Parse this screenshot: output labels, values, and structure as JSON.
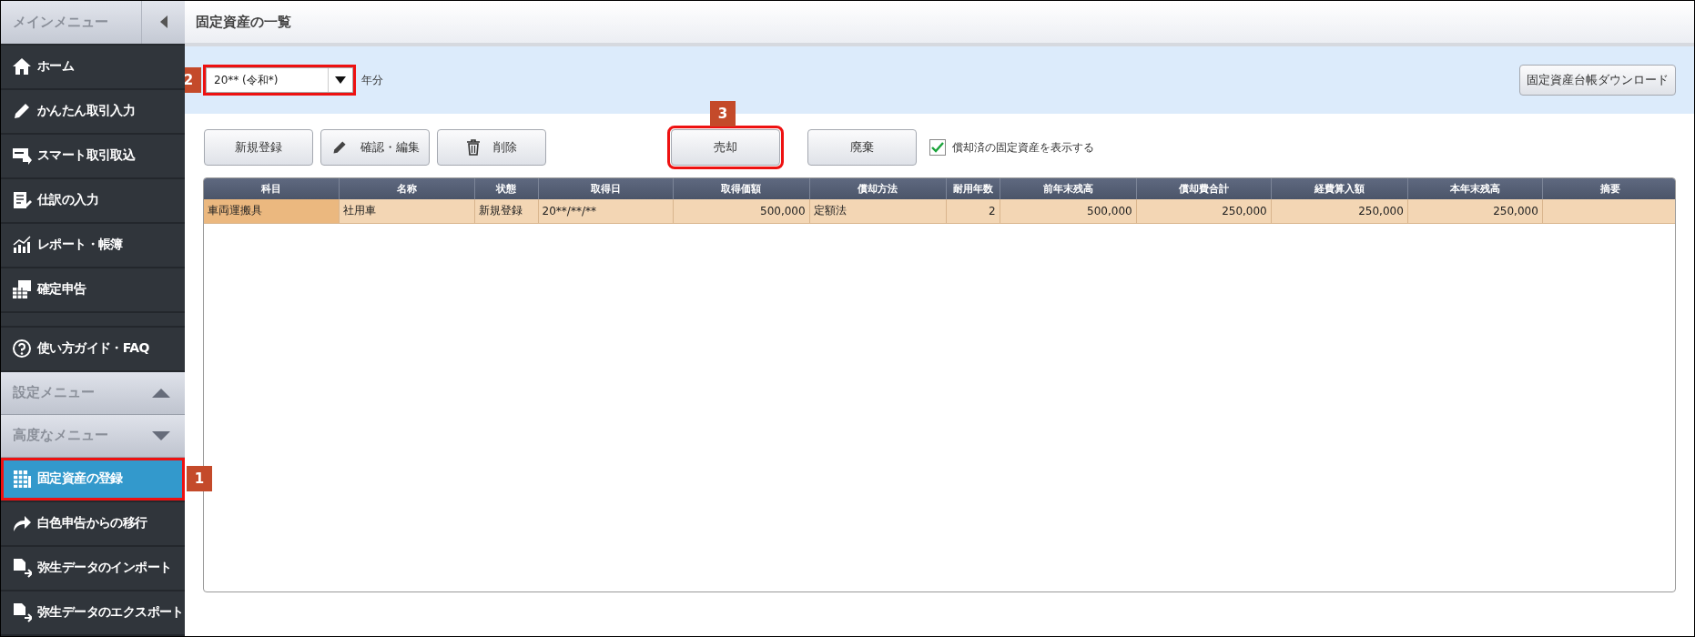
{
  "sidebar": {
    "title": "メインメニュー",
    "entries": [
      {
        "kind": "item",
        "label": "ホーム",
        "selected": false
      },
      {
        "kind": "item",
        "label": "かんたん取引入力",
        "selected": false
      },
      {
        "kind": "item",
        "label": "スマート取引取込",
        "selected": false
      },
      {
        "kind": "item",
        "label": "仕訳の入力",
        "selected": false
      },
      {
        "kind": "item",
        "label": "レポート・帳簿",
        "selected": false
      },
      {
        "kind": "item",
        "label": "確定申告",
        "selected": false
      },
      {
        "kind": "help",
        "label": "使い方ガイド・FAQ",
        "selected": false
      },
      {
        "kind": "section",
        "label": "設定メニュー",
        "expanded": true
      },
      {
        "kind": "section",
        "label": "高度なメニュー",
        "expanded": false
      },
      {
        "kind": "item",
        "label": "固定資産の登録",
        "selected": true,
        "callout": "1"
      },
      {
        "kind": "item",
        "label": "白色申告からの移行",
        "selected": false
      },
      {
        "kind": "item",
        "label": "弥生データのインポート",
        "selected": false
      },
      {
        "kind": "item",
        "label": "弥生データのエクスポート",
        "selected": false
      }
    ]
  },
  "page": {
    "title": "固定資産の一覧"
  },
  "filter": {
    "year": "20** (令和*)",
    "suffix": "年分",
    "callout": "2",
    "download": "固定資産台帳ダウンロード"
  },
  "toolbar": {
    "left_buttons": [
      {
        "label": "新規登録"
      },
      {
        "label": "確認・編集"
      },
      {
        "label": "削除"
      }
    ],
    "right_buttons": [
      {
        "label": "売却",
        "callout": "3"
      },
      {
        "label": "廃棄"
      }
    ],
    "checkbox": {
      "label": "償却済の固定資産を表示する",
      "checked": true
    }
  },
  "table": {
    "columns": [
      "科目",
      "名称",
      "状態",
      "取得日",
      "取得価額",
      "償却方法",
      "耐用年数",
      "前年末残高",
      "償却費合計",
      "経費算入額",
      "本年末残高",
      "摘要"
    ],
    "rows": [
      {
        "selected": true,
        "cells": [
          "車両運搬具",
          "社用車",
          "新規登録",
          "20**/**/**",
          "500,000",
          "定額法",
          "2",
          "500,000",
          "250,000",
          "250,000",
          "250,000",
          ""
        ]
      }
    ]
  }
}
